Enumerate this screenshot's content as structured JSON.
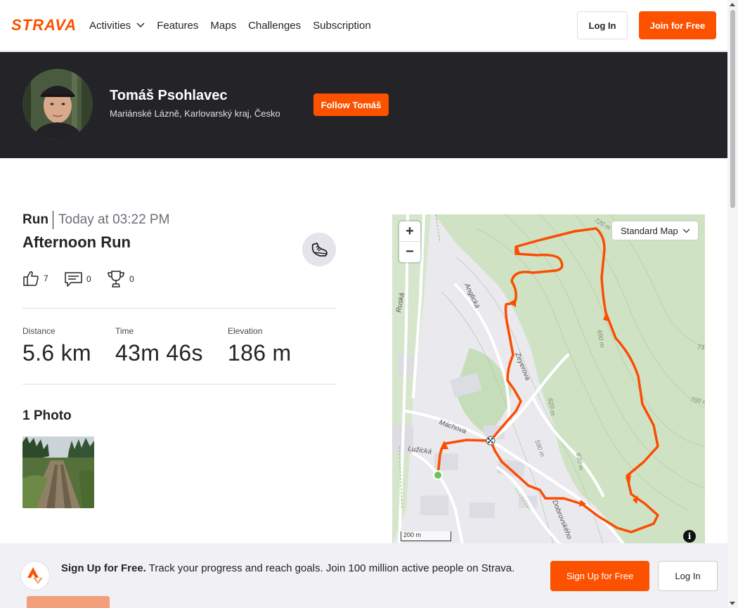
{
  "nav": {
    "logo_text": "STRAVA",
    "items": [
      {
        "label": "Activities",
        "dropdown": true
      },
      {
        "label": "Features"
      },
      {
        "label": "Maps"
      },
      {
        "label": "Challenges"
      },
      {
        "label": "Subscription"
      }
    ],
    "login_label": "Log In",
    "join_label": "Join for Free"
  },
  "athlete": {
    "name": "Tomáš Psohlavec",
    "location": "Mariánské Lázně, Karlovarský kraj, Česko",
    "follow_label": "Follow Tomáš"
  },
  "activity": {
    "type": "Run",
    "date": "Today at 03:22 PM",
    "title": "Afternoon Run",
    "kudos": "7",
    "comments": "0",
    "achievements": "0",
    "stats": [
      {
        "label": "Distance",
        "value": "5.6 km"
      },
      {
        "label": "Time",
        "value": "43m 46s"
      },
      {
        "label": "Elevation",
        "value": "186 m"
      }
    ],
    "photos_title": "1 Photo"
  },
  "map": {
    "style_label": "Standard Map",
    "zoom_in": "+",
    "zoom_out": "−",
    "scale_label": "200 m",
    "info": "i",
    "route_color": "#fc4c02",
    "streets": [
      "Ruská",
      "Anglická",
      "Zeyerova",
      "Máchova",
      "Lužická",
      "Dobrovského"
    ],
    "contours": [
      "720 m",
      "690 m",
      "620 m",
      "590 m",
      "630 m",
      "700 m",
      "73"
    ]
  },
  "signup": {
    "headline": "Sign Up for Free.",
    "body": "Track your progress and reach goals. Join 100 million active people on Strava.",
    "signup_label": "Sign Up for Free",
    "login_label": "Log In"
  },
  "colors": {
    "brand": "#fc5200",
    "dark": "#242428"
  }
}
